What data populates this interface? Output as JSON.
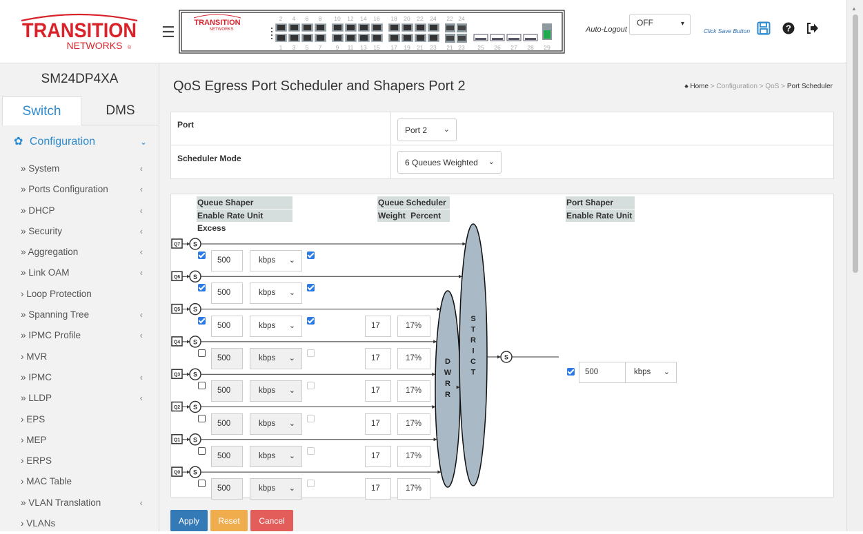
{
  "brand": {
    "logo_top": "TRANSITION",
    "logo_bottom": "NETWORKS",
    "panel_logo_top": "TRANSITION",
    "panel_logo_bottom": "NETWORKS"
  },
  "device_name": "SM24DP4XA",
  "tabs": [
    {
      "label": "Switch",
      "active": true
    },
    {
      "label": "DMS",
      "active": false
    }
  ],
  "menu": {
    "section": "Configuration",
    "items": [
      {
        "label": "» System",
        "chevron": "‹"
      },
      {
        "label": "» Ports Configuration",
        "chevron": "‹"
      },
      {
        "label": "» DHCP",
        "chevron": "‹"
      },
      {
        "label": "» Security",
        "chevron": "‹"
      },
      {
        "label": "» Aggregation",
        "chevron": "‹"
      },
      {
        "label": "» Link OAM",
        "chevron": "‹"
      },
      {
        "label": "› Loop Protection",
        "chevron": ""
      },
      {
        "label": "» Spanning Tree",
        "chevron": "‹"
      },
      {
        "label": "» IPMC Profile",
        "chevron": "‹"
      },
      {
        "label": "› MVR",
        "chevron": ""
      },
      {
        "label": "» IPMC",
        "chevron": "‹"
      },
      {
        "label": "» LLDP",
        "chevron": "‹"
      },
      {
        "label": "› EPS",
        "chevron": ""
      },
      {
        "label": "› MEP",
        "chevron": ""
      },
      {
        "label": "› ERPS",
        "chevron": ""
      },
      {
        "label": "› MAC Table",
        "chevron": ""
      },
      {
        "label": "» VLAN Translation",
        "chevron": "‹"
      },
      {
        "label": "› VLANs",
        "chevron": ""
      }
    ]
  },
  "panel": {
    "top_numbers": [
      "2",
      "4",
      "6",
      "8",
      "10",
      "12",
      "14",
      "16",
      "18",
      "20",
      "22",
      "24"
    ],
    "bottom_numbers": [
      "1",
      "3",
      "5",
      "7",
      "9",
      "11",
      "13",
      "15",
      "17",
      "19",
      "21",
      "23",
      "25",
      "26",
      "27",
      "28",
      "29"
    ],
    "extra_top": [
      "22",
      "24"
    ],
    "extra_bottom": [
      "21",
      "23"
    ]
  },
  "topbar": {
    "autologout_label": "Auto-Logout",
    "autologout_value": "OFF",
    "save_text": "Click Save Button",
    "icons": [
      "save-icon",
      "help-icon",
      "logout-icon",
      "menu-icon"
    ]
  },
  "page": {
    "title": "QoS Egress Port Scheduler and Shapers  Port 2",
    "breadcrumb": {
      "home": "Home",
      "sep": ">",
      "parts": [
        "Configuration",
        "QoS",
        "Port Scheduler"
      ]
    }
  },
  "settings": {
    "port_label": "Port",
    "port_value": "Port 2",
    "mode_label": "Scheduler Mode",
    "mode_value": "6 Queues Weighted"
  },
  "diagram": {
    "queue_shaper_header": "Queue Shaper",
    "queue_shaper_cols": [
      "Enable",
      "Rate",
      "Unit",
      "Excess"
    ],
    "queue_scheduler_header": "Queue Scheduler",
    "queue_scheduler_cols": [
      "Weight",
      "Percent"
    ],
    "port_shaper_header": "Port Shaper",
    "port_shaper_cols": [
      "Enable",
      "Rate",
      "Unit"
    ],
    "scheduler_node": "S",
    "dwrr_label": [
      "D",
      "W",
      "R",
      "R"
    ],
    "strict_label": [
      "S",
      "T",
      "R",
      "I",
      "C",
      "T"
    ],
    "queues": [
      {
        "name": "Q7",
        "enable": true,
        "rate": "500",
        "unit": "kbps",
        "excess": true,
        "weight": "",
        "percent": ""
      },
      {
        "name": "Q6",
        "enable": true,
        "rate": "500",
        "unit": "kbps",
        "excess": true,
        "weight": "",
        "percent": ""
      },
      {
        "name": "Q5",
        "enable": true,
        "rate": "500",
        "unit": "kbps",
        "excess": true,
        "weight": "17",
        "percent": "17%"
      },
      {
        "name": "Q4",
        "enable": false,
        "rate": "500",
        "unit": "kbps",
        "excess": false,
        "weight": "17",
        "percent": "17%"
      },
      {
        "name": "Q3",
        "enable": false,
        "rate": "500",
        "unit": "kbps",
        "excess": false,
        "weight": "17",
        "percent": "17%"
      },
      {
        "name": "Q2",
        "enable": false,
        "rate": "500",
        "unit": "kbps",
        "excess": false,
        "weight": "17",
        "percent": "17%"
      },
      {
        "name": "Q1",
        "enable": false,
        "rate": "500",
        "unit": "kbps",
        "excess": false,
        "weight": "17",
        "percent": "17%"
      },
      {
        "name": "Q0",
        "enable": false,
        "rate": "500",
        "unit": "kbps",
        "excess": false,
        "weight": "17",
        "percent": "17%"
      }
    ],
    "port_shaper": {
      "enable": true,
      "rate": "500",
      "unit": "kbps"
    }
  },
  "buttons": {
    "apply": "Apply",
    "reset": "Reset",
    "cancel": "Cancel"
  },
  "colors": {
    "accent": "#2c8ad0",
    "apply": "#337ab7",
    "reset": "#f0ad4e",
    "cancel": "#e35d5b",
    "scheduler_fill": "#a9bac6",
    "logo_red": "#d8232a"
  }
}
